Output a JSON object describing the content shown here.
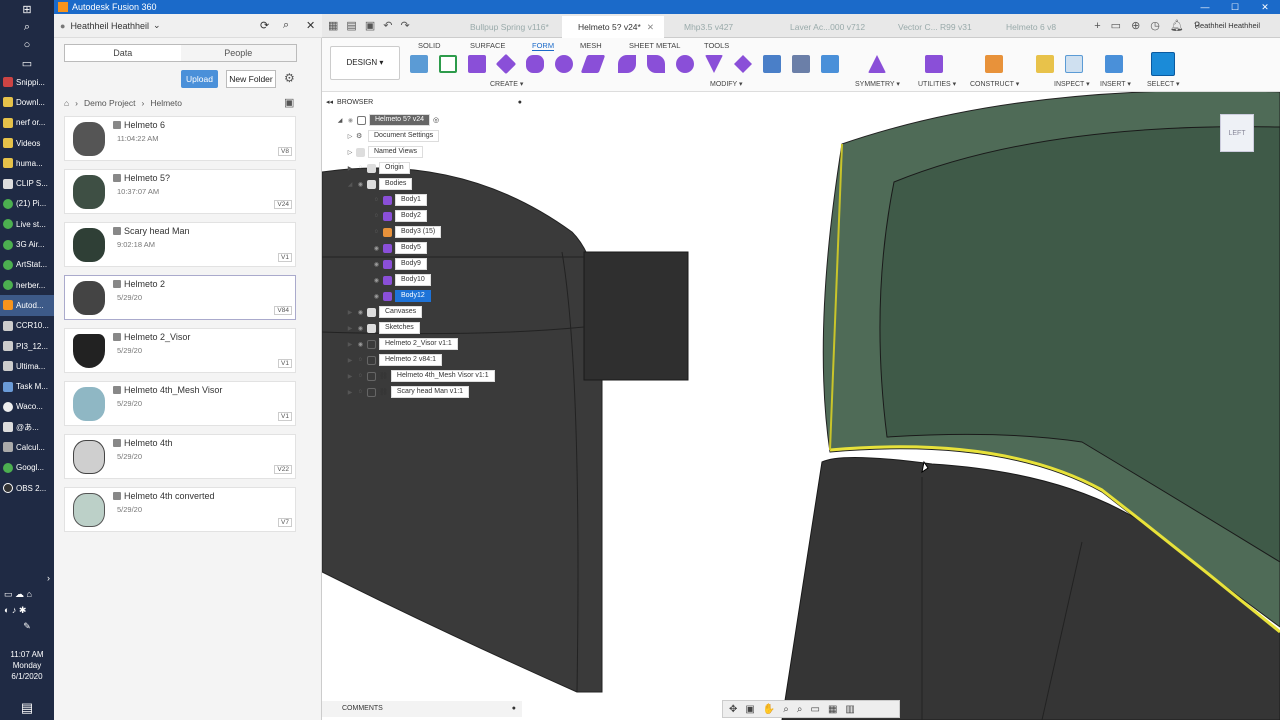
{
  "window": {
    "title": "Autodesk Fusion 360",
    "controls": [
      "—",
      "☐",
      "✕"
    ]
  },
  "taskbar": {
    "items": [
      "Snippi...",
      "Downl...",
      "nerf or...",
      "Videos",
      "huma...",
      "CLIP S...",
      "(21) Pi...",
      "Live st...",
      "3G Air...",
      "ArtStat...",
      "herber...",
      "Autod...",
      "CCR10...",
      "PI3_12...",
      "Ultima...",
      "Task M...",
      "Waco...",
      "@あ...",
      "Calcul...",
      "Googl...",
      "OBS 2..."
    ],
    "time": "11:07 AM",
    "day": "Monday",
    "date": "6/1/2020"
  },
  "data_panel": {
    "team": "Heathheil Heathheil",
    "tabs": [
      "Data",
      "People"
    ],
    "upload_label": "Upload",
    "new_folder_label": "New Folder",
    "breadcrumb": [
      "Demo Project",
      "Helmeto"
    ],
    "files": [
      {
        "name": "Helmeto 6",
        "time": "11:04:22 AM",
        "version": "V8"
      },
      {
        "name": "Helmeto 5?",
        "time": "10:37:07 AM",
        "version": "V24"
      },
      {
        "name": "Scary head Man",
        "time": "9:02:18 AM",
        "version": "V1"
      },
      {
        "name": "Helmeto 2",
        "time": "5/29/20",
        "version": "V84"
      },
      {
        "name": "Helmeto 2_Visor",
        "time": "5/29/20",
        "version": "V1"
      },
      {
        "name": "Helmeto 4th_Mesh Visor",
        "time": "5/29/20",
        "version": "V1"
      },
      {
        "name": "Helmeto 4th",
        "time": "5/29/20",
        "version": "V22"
      },
      {
        "name": "Helmeto 4th converted",
        "time": "5/29/20",
        "version": "V7"
      }
    ]
  },
  "tabs": [
    {
      "label": "Bullpup Spring v116*"
    },
    {
      "label": "Helmeto 5? v24*"
    },
    {
      "label": "Mhp3.5 v427"
    },
    {
      "label": "Laver Ac...000 v712"
    },
    {
      "label": "Vector C... R99 v31"
    },
    {
      "label": "Helmeto 6 v8"
    }
  ],
  "user": {
    "name": "Heathheil Heathheil"
  },
  "ribbon": {
    "workspace": "DESIGN ▾",
    "tabs": [
      "SOLID",
      "SURFACE",
      "FORM",
      "MESH",
      "SHEET METAL",
      "TOOLS"
    ],
    "groups": [
      "CREATE ▾",
      "MODIFY ▾",
      "SYMMETRY ▾",
      "UTILITIES ▾",
      "CONSTRUCT ▾",
      "INSPECT ▾",
      "INSERT ▾",
      "SELECT ▾"
    ]
  },
  "browser": {
    "title": "BROWSER",
    "root": "Helmeto 5? v24",
    "nodes": {
      "doc_settings": "Document Settings",
      "named_views": "Named Views",
      "origin": "Origin",
      "bodies": "Bodies",
      "body1": "Body1",
      "body2": "Body2",
      "body3": "Body3 (15)",
      "body5": "Body5",
      "body9": "Body9",
      "body10": "Body10",
      "body12": "Body12",
      "canvases": "Canvases",
      "sketches": "Sketches",
      "visor": "Helmeto 2_Visor v1:1",
      "helmeto2": "Helmeto 2 v84:1",
      "mesh_visor": "Helmeto 4th_Mesh Visor v1:1",
      "scary": "Scary head Man v1:1"
    }
  },
  "viewcube": {
    "face": "LEFT"
  },
  "comments": {
    "label": "COMMENTS"
  },
  "colors": {
    "accent": "#1b6ac9",
    "selection": "#1e73d8",
    "model_dark": "#3a3a3a",
    "model_green": "#4f6b57",
    "edge_highlight": "#e8e23a"
  }
}
